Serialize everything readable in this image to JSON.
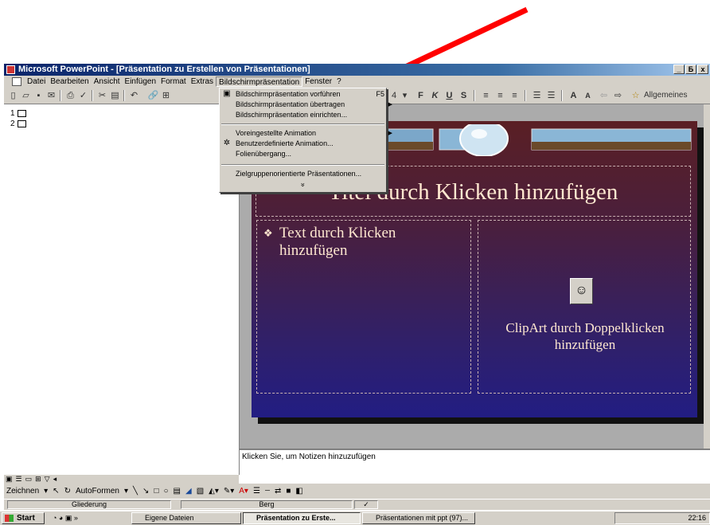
{
  "window": {
    "title": "Microsoft PowerPoint - [Präsentation zu Erstellen von Präsentationen]",
    "controls": [
      "_",
      "Б",
      "x"
    ]
  },
  "menubar": {
    "items": [
      "Datei",
      "Bearbeiten",
      "Ansicht",
      "Einfügen",
      "Format",
      "Extras",
      "Bildschirmpräsentation",
      "Fenster",
      "?"
    ],
    "active": "Bildschirmpräsentation"
  },
  "toolbar": {
    "font_size": "4",
    "bold": "F",
    "italic": "K",
    "underline": "U",
    "shadow": "S",
    "design_label": "Allgemeines"
  },
  "outline": {
    "slides": [
      "1",
      "2"
    ]
  },
  "dropdown": {
    "items": [
      {
        "label": "Bildschirmpräsentation vorführen",
        "shortcut": "F5",
        "icon": "slideshow-icon"
      },
      {
        "label": "Bildschirmpräsentation übertragen",
        "submenu": true
      },
      {
        "label": "Bildschirmpräsentation einrichten..."
      },
      {
        "label": "Voreingestellte Animation",
        "submenu": true
      },
      {
        "label": "Benutzerdefinierte Animation...",
        "icon": "animation-icon"
      },
      {
        "label": "Folienübergang..."
      },
      {
        "label": "Zielgruppenorientierte Präsentationen..."
      }
    ],
    "more": "»"
  },
  "slide": {
    "title_placeholder": "Titel durch Klicken hinzufügen",
    "text_placeholder": "Text durch Klicken hinzufügen",
    "bullet": "❖",
    "clipart_placeholder": "ClipArt durch Doppelklicken hinzufügen"
  },
  "notes": {
    "placeholder": "Klicken Sie, um Notizen hinzuzufügen"
  },
  "drawbar": {
    "draw_label": "Zeichnen",
    "autoshapes_label": "AutoFormen"
  },
  "statusbar": {
    "view": "Gliederung",
    "design": "Berg"
  },
  "taskbar": {
    "start": "Start",
    "tasks": [
      "Eigene Dateien",
      "Präsentation zu Erste...",
      "Präsentationen mit ppt (97)..."
    ],
    "active_task": "Präsentation zu Erste...",
    "clock": "22:16"
  },
  "colors": {
    "arrow": "#ff0000",
    "titlebar": "#0a246a",
    "slide_top": "#5a1f24",
    "slide_bottom": "#221d83"
  }
}
